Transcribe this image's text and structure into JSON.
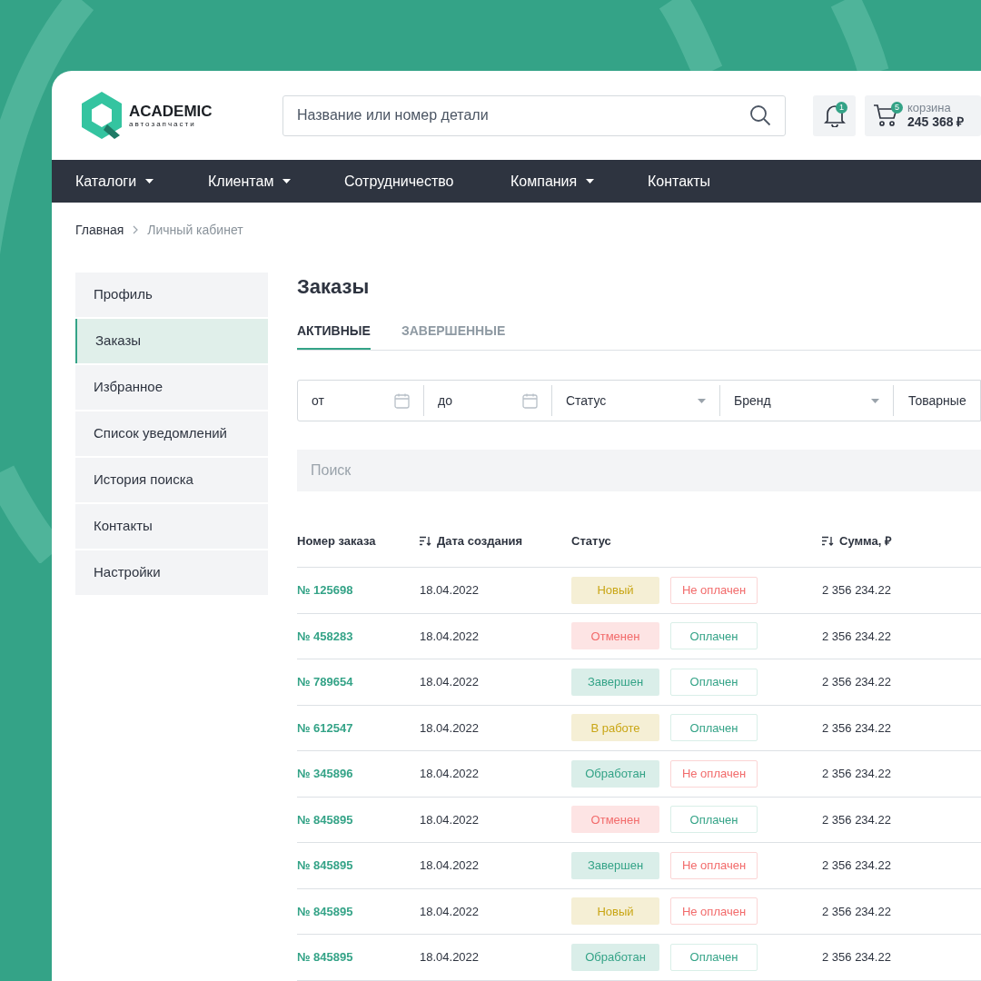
{
  "logo": {
    "name": "ACADEMIC",
    "tagline": "автозапчасти"
  },
  "search": {
    "placeholder": "Название или номер детали"
  },
  "notifications": {
    "count": "1"
  },
  "cart": {
    "count": "5",
    "label": "корзина",
    "total": "245 368 ₽"
  },
  "nav": [
    {
      "label": "Каталоги",
      "dropdown": true
    },
    {
      "label": "Клиентам",
      "dropdown": true
    },
    {
      "label": "Сотрудничество",
      "dropdown": false
    },
    {
      "label": "Компания",
      "dropdown": true
    },
    {
      "label": "Контакты",
      "dropdown": false
    }
  ],
  "breadcrumbs": [
    "Главная",
    "Личный кабинет"
  ],
  "sidebar": {
    "items": [
      {
        "label": "Профиль",
        "selected": false
      },
      {
        "label": "Заказы",
        "selected": true
      },
      {
        "label": "Избранное",
        "selected": false
      },
      {
        "label": "Список уведомлений",
        "selected": false
      },
      {
        "label": "История поиска",
        "selected": false
      },
      {
        "label": "Контакты",
        "selected": false
      },
      {
        "label": "Настройки",
        "selected": false
      }
    ]
  },
  "page_title": "Заказы",
  "tabs": [
    {
      "label": "АКТИВНЫЕ",
      "selected": true
    },
    {
      "label": "ЗАВЕРШЕННЫЕ",
      "selected": false
    }
  ],
  "filters": [
    {
      "kind": "date",
      "label": "от"
    },
    {
      "kind": "date",
      "label": "до"
    },
    {
      "kind": "select",
      "label": "Статус"
    },
    {
      "kind": "select",
      "label": "Бренд"
    },
    {
      "kind": "text",
      "label": "Товарные"
    }
  ],
  "order_search": {
    "placeholder": "Поиск"
  },
  "table": {
    "columns": [
      {
        "label": "Номер заказа",
        "sortable": false
      },
      {
        "label": "Дата создания",
        "sortable": true
      },
      {
        "label": "Статус",
        "sortable": false
      },
      {
        "label": "Сумма, ₽",
        "sortable": true
      }
    ],
    "rows": [
      {
        "number": "№ 125698",
        "date": "18.04.2022",
        "status": "Новый",
        "color": "#c9a615",
        "payment": "Не оплачен",
        "paid": false,
        "sum": "2 356 234.22"
      },
      {
        "number": "№ 458283",
        "date": "18.04.2022",
        "status": "Отменен",
        "color": "#f26b6b",
        "payment": "Оплачен",
        "paid": true,
        "sum": "2 356 234.22"
      },
      {
        "number": "№ 789654",
        "date": "18.04.2022",
        "status": "Завершен",
        "color": "#34a387",
        "payment": "Оплачен",
        "paid": true,
        "sum": "2 356 234.22"
      },
      {
        "number": "№ 612547",
        "date": "18.04.2022",
        "status": "В работе",
        "color": "#c9a615",
        "payment": "Оплачен",
        "paid": true,
        "sum": "2 356 234.22"
      },
      {
        "number": "№ 345896",
        "date": "18.04.2022",
        "status": "Обработан",
        "color": "#34a387",
        "payment": "Не оплачен",
        "paid": false,
        "sum": "2 356 234.22"
      },
      {
        "number": "№ 845895",
        "date": "18.04.2022",
        "status": "Отменен",
        "color": "#f26b6b",
        "payment": "Оплачен",
        "paid": true,
        "sum": "2 356 234.22"
      },
      {
        "number": "№ 845895",
        "date": "18.04.2022",
        "status": "Завершен",
        "color": "#34a387",
        "payment": "Не оплачен",
        "paid": false,
        "sum": "2 356 234.22"
      },
      {
        "number": "№ 845895",
        "date": "18.04.2022",
        "status": "Новый",
        "color": "#c9a615",
        "payment": "Не оплачен",
        "paid": false,
        "sum": "2 356 234.22"
      },
      {
        "number": "№ 845895",
        "date": "18.04.2022",
        "status": "Обработан",
        "color": "#34a387",
        "payment": "Оплачен",
        "paid": true,
        "sum": "2 356 234.22"
      }
    ]
  }
}
